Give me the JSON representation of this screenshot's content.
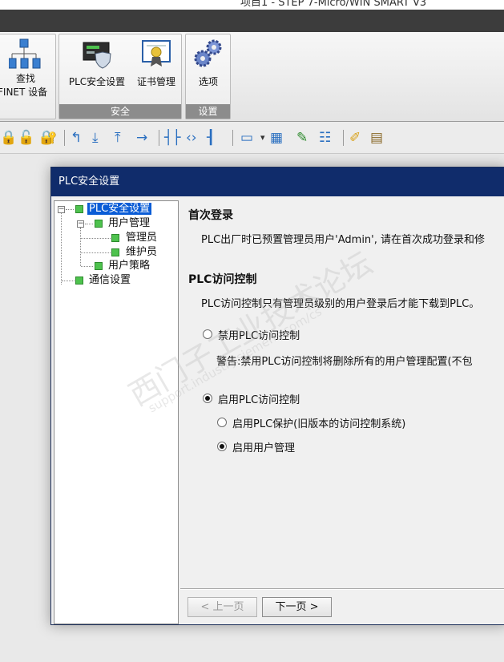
{
  "window": {
    "title": "项目1 - STEP 7-Micro/WIN SMART V3"
  },
  "ribbon": {
    "find_label_line1": "查找",
    "find_label_line2": "FINET 设备",
    "plc_security_label": "PLC安全设置",
    "cert_label": "证书管理",
    "group_security": "安全",
    "options_label": "选项",
    "group_settings": "设置"
  },
  "dialog": {
    "title": "PLC安全设置",
    "tree": {
      "root": "PLC安全设置",
      "user_mgmt": "用户管理",
      "admin": "管理员",
      "maintainer": "维护员",
      "user_policy": "用户策略",
      "comm_settings": "通信设置"
    },
    "first_login": {
      "heading": "首次登录",
      "text": "PLC出厂时已预置管理员用户'Admin', 请在首次成功登录和修"
    },
    "access_control": {
      "heading": "PLC访问控制",
      "text": "PLC访问控制只有管理员级别的用户登录后才能下载到PLC。",
      "disable_label": "禁用PLC访问控制",
      "warning": "警告:禁用PLC访问控制将删除所有的用户管理配置(不包",
      "enable_label": "启用PLC访问控制",
      "legacy_label": "启用PLC保护(旧版本的访问控制系统)",
      "user_mgmt_label": "启用用户管理",
      "selected_mode": "启用PLC访问控制",
      "selected_sub": "启用用户管理"
    },
    "buttons": {
      "prev": "< 上一页",
      "next": "下一页 >"
    }
  },
  "watermark": {
    "line1": "西门子工业技术论坛",
    "line2": "support.industry.siemens.com/cs"
  }
}
